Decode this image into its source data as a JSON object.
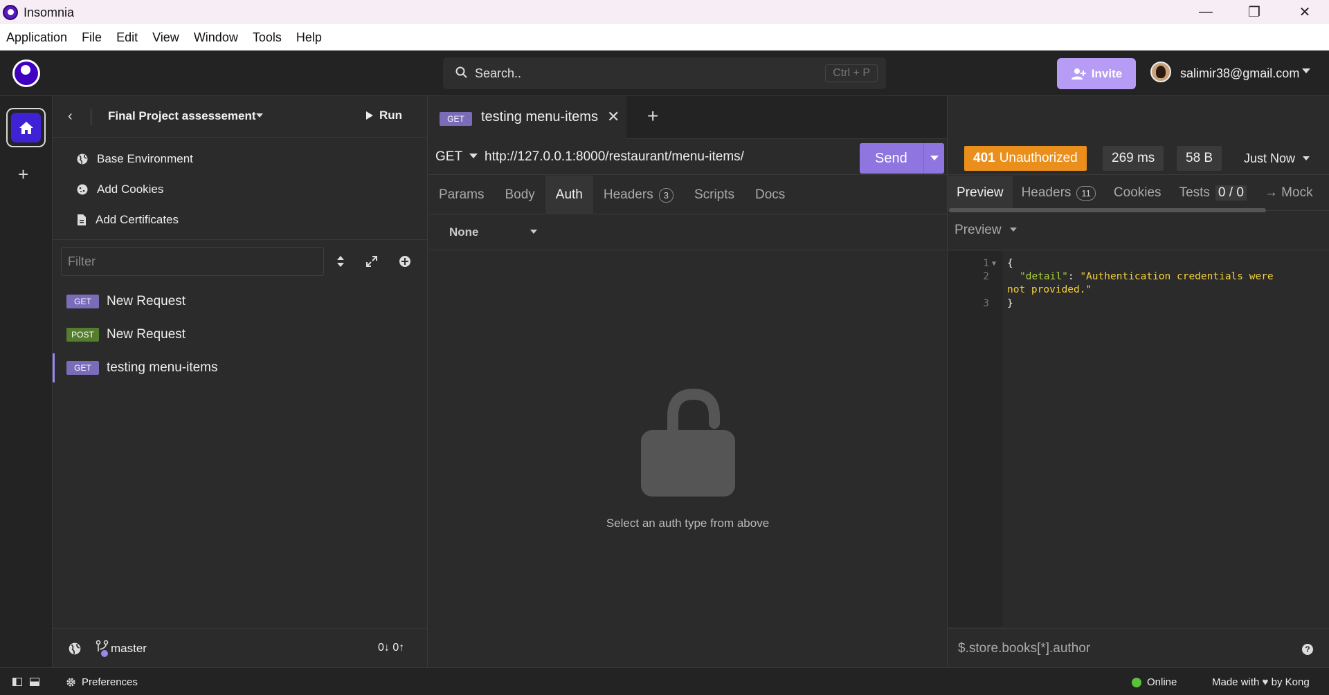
{
  "window": {
    "title": "Insomnia",
    "minimize": "—",
    "maximize": "❐",
    "close": "✕"
  },
  "menu": [
    "Application",
    "File",
    "Edit",
    "View",
    "Window",
    "Tools",
    "Help"
  ],
  "header": {
    "search_placeholder": "Search..",
    "search_shortcut": "Ctrl + P",
    "invite_label": "Invite",
    "user_email": "salimir38@gmail.com"
  },
  "sidebar": {
    "project_name": "Final Project assessement",
    "run_label": "Run",
    "nav": [
      {
        "label": "Base Environment",
        "icon": "globe-icon"
      },
      {
        "label": "Add Cookies",
        "icon": "cookie-icon"
      },
      {
        "label": "Add Certificates",
        "icon": "certificate-icon"
      }
    ],
    "filter_placeholder": "Filter",
    "requests": [
      {
        "method": "GET",
        "name": "New Request",
        "active": false
      },
      {
        "method": "POST",
        "name": "New Request",
        "active": false
      },
      {
        "method": "GET",
        "name": "testing menu-items",
        "active": true
      }
    ],
    "branch": "master",
    "sync": "0↓ 0↑"
  },
  "request": {
    "tab_method": "GET",
    "tab_title": "testing menu-items",
    "method": "GET",
    "url": "http://127.0.0.1:8000/restaurant/menu-items/",
    "send_label": "Send",
    "tabs": [
      {
        "label": "Params",
        "count": null,
        "active": false
      },
      {
        "label": "Body",
        "count": null,
        "active": false
      },
      {
        "label": "Auth",
        "count": null,
        "active": true
      },
      {
        "label": "Headers",
        "count": "3",
        "active": false
      },
      {
        "label": "Scripts",
        "count": null,
        "active": false
      },
      {
        "label": "Docs",
        "count": null,
        "active": false
      }
    ],
    "auth_type": "None",
    "empty_message": "Select an auth type from above"
  },
  "response": {
    "status_code": "401",
    "status_text": "Unauthorized",
    "time": "269 ms",
    "size": "58 B",
    "when": "Just Now",
    "tabs": [
      {
        "label": "Preview",
        "count": null,
        "active": true
      },
      {
        "label": "Headers",
        "count": "11",
        "active": false
      },
      {
        "label": "Cookies",
        "count": null,
        "active": false
      },
      {
        "label": "Tests",
        "count": "0 / 0",
        "active": false
      },
      {
        "label": "→ Mock",
        "count": null,
        "active": false
      }
    ],
    "preview_mode": "Preview",
    "code": {
      "line_numbers": [
        "1",
        "2",
        "",
        "3"
      ],
      "open_brace": "{",
      "key": "\"detail\"",
      "colon": ": ",
      "value_part1": "\"Authentication credentials were",
      "value_part2": "not provided.\"",
      "close_brace": "}"
    },
    "jsonpath_placeholder": "$.store.books[*].author"
  },
  "footer": {
    "preferences": "Preferences",
    "status": "Online",
    "made_with": "Made with",
    "by": "by Kong"
  }
}
